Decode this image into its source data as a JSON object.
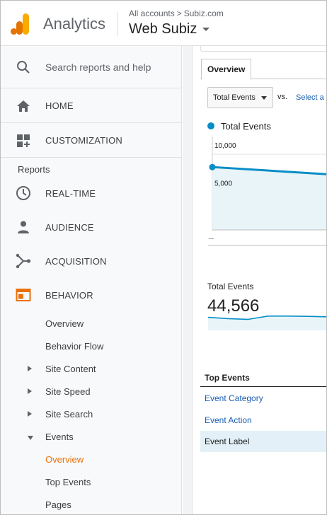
{
  "header": {
    "app_name": "Analytics",
    "breadcrumb": {
      "account": "All accounts",
      "separator": ">",
      "property": "Subiz.com"
    },
    "view_name": "Web Subiz"
  },
  "sidebar": {
    "search_label": "Search reports and help",
    "home_label": "HOME",
    "customization_label": "CUSTOMIZATION",
    "reports_heading": "Reports",
    "nav": [
      {
        "label": "REAL-TIME",
        "icon": "clock-icon"
      },
      {
        "label": "AUDIENCE",
        "icon": "person-icon"
      },
      {
        "label": "ACQUISITION",
        "icon": "acquisition-icon"
      },
      {
        "label": "BEHAVIOR",
        "icon": "behavior-icon",
        "icon_color": "#e8710a"
      }
    ],
    "behavior_items": [
      {
        "label": "Overview",
        "expandable": false
      },
      {
        "label": "Behavior Flow",
        "expandable": false
      },
      {
        "label": "Site Content",
        "expandable": true,
        "expanded": false
      },
      {
        "label": "Site Speed",
        "expandable": true,
        "expanded": false
      },
      {
        "label": "Site Search",
        "expandable": true,
        "expanded": false
      },
      {
        "label": "Events",
        "expandable": true,
        "expanded": true
      }
    ],
    "events_items": [
      {
        "label": "Overview",
        "active": true
      },
      {
        "label": "Top Events",
        "active": false
      },
      {
        "label": "Pages",
        "active": false
      }
    ]
  },
  "main": {
    "tab_label": "Overview",
    "metric_select": "Total Events",
    "vs_label": "vs.",
    "select_metric_link": "Select a m",
    "legend_label": "Total Events",
    "total_label": "Total Events",
    "total_value": "44,566",
    "top_events_heading": "Top Events",
    "event_dimensions": [
      "Event Category",
      "Event Action",
      "Event Label"
    ],
    "selected_dimension": "Event Label"
  },
  "chart_data": {
    "type": "area",
    "series": [
      {
        "name": "Total Events",
        "values": [
          8300,
          7350
        ]
      }
    ],
    "tick_labels": [
      "10,000",
      "5,000"
    ],
    "x_tick_label": "...",
    "ylim": [
      0,
      10000
    ],
    "series_color": "#058dc7",
    "fill_color": "#e9f4f9"
  },
  "spark_data": {
    "values": [
      40,
      35,
      32,
      45,
      45,
      44,
      42
    ]
  },
  "colors": {
    "accent": "#e8710a",
    "link": "#1a5fb4",
    "selected_row": "#e3f0f7"
  }
}
